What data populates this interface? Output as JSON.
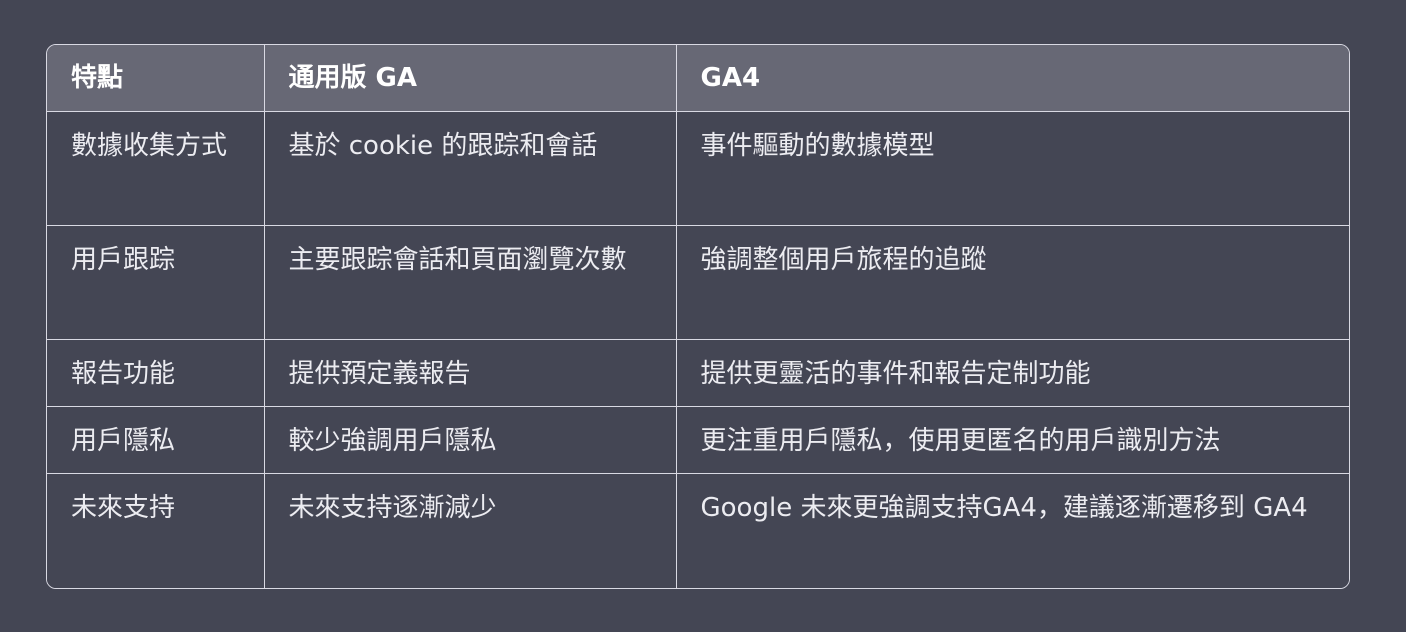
{
  "table": {
    "headers": [
      "特點",
      "通用版 GA",
      "GA4"
    ],
    "rows": [
      [
        "數據收集方式",
        "基於 cookie 的跟踪和會話",
        "事件驅動的數據模型"
      ],
      [
        "用戶跟踪",
        "主要跟踪會話和頁面瀏覽次數",
        "強調整個用戶旅程的追蹤"
      ],
      [
        "報告功能",
        "提供預定義報告",
        "提供更靈活的事件和報告定制功能"
      ],
      [
        "用戶隱私",
        "較少強調用戶隱私",
        "更注重用戶隱私，使用更匿名的用戶識別方法"
      ],
      [
        "未來支持",
        "未來支持逐漸減少",
        "Google 未來更強調支持GA4，建議逐漸遷移到 GA4"
      ]
    ]
  },
  "colors": {
    "background": "#444654",
    "header_background": "#676875",
    "border": "#d9d9e3",
    "text": "#ececf1"
  }
}
